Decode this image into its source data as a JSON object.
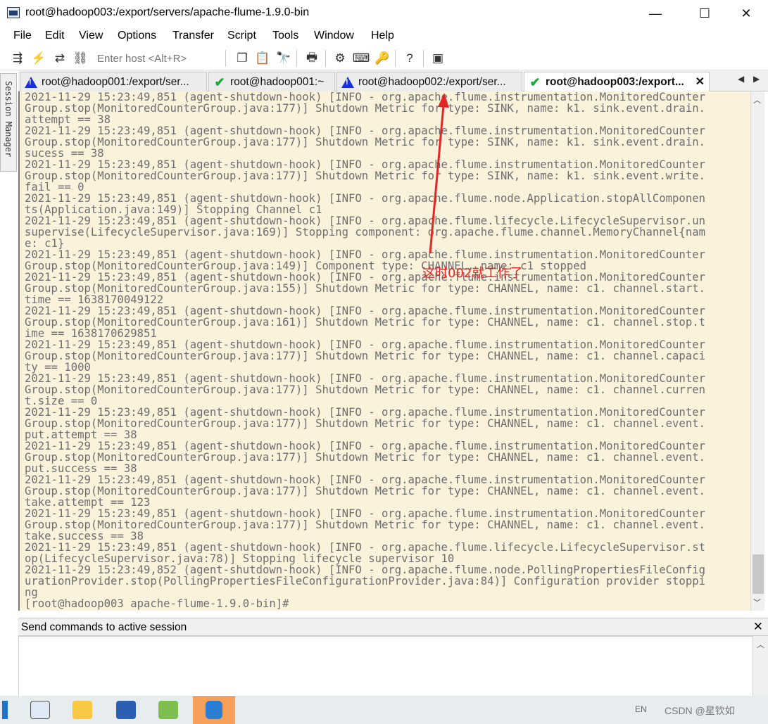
{
  "window": {
    "title": "root@hadoop003:/export/servers/apache-flume-1.9.0-bin",
    "minimize": "—",
    "maximize": "☐",
    "close": "✕"
  },
  "menu": [
    "File",
    "Edit",
    "View",
    "Options",
    "Transfer",
    "Script",
    "Tools",
    "Window",
    "Help"
  ],
  "toolbar": {
    "host_placeholder": "Enter host <Alt+R>",
    "icons": [
      "connect-icon",
      "quick-connect-icon",
      "reconnect-icon",
      "disconnect-icon",
      "copy-icon",
      "paste-icon",
      "find-icon",
      "print-icon",
      "settings-icon",
      "keymap-icon",
      "key-icon",
      "help-icon",
      "sftp-icon"
    ]
  },
  "session_manager": {
    "label": "Session Manager"
  },
  "tabs": [
    {
      "label": "root@hadoop001:/export/ser...",
      "status": "warning",
      "active": false
    },
    {
      "label": "root@hadoop001:~",
      "status": "ok",
      "active": false
    },
    {
      "label": "root@hadoop002:/export/ser...",
      "status": "warning",
      "active": false
    },
    {
      "label": "root@hadoop003:/export...",
      "status": "ok",
      "active": true
    }
  ],
  "terminal": {
    "lines": [
      "2021-11-29 15:23:49,851 (agent-shutdown-hook) [INFO - org.apache.flume.instrumentation.MonitoredCounter",
      "Group.stop(MonitoredCounterGroup.java:177)] Shutdown Metric for type: SINK, name: k1. sink.event.drain.",
      "attempt == 38",
      "2021-11-29 15:23:49,851 (agent-shutdown-hook) [INFO - org.apache.flume.instrumentation.MonitoredCounter",
      "Group.stop(MonitoredCounterGroup.java:177)] Shutdown Metric for type: SINK, name: k1. sink.event.drain.",
      "sucess == 38",
      "2021-11-29 15:23:49,851 (agent-shutdown-hook) [INFO - org.apache.flume.instrumentation.MonitoredCounter",
      "Group.stop(MonitoredCounterGroup.java:177)] Shutdown Metric for type: SINK, name: k1. sink.event.write.",
      "fail == 0",
      "2021-11-29 15:23:49,851 (agent-shutdown-hook) [INFO - org.apache.flume.node.Application.stopAllComponen",
      "ts(Application.java:149)] Stopping Channel c1",
      "2021-11-29 15:23:49,851 (agent-shutdown-hook) [INFO - org.apache.flume.lifecycle.LifecycleSupervisor.un",
      "supervise(LifecycleSupervisor.java:169)] Stopping component: org.apache.flume.channel.MemoryChannel{nam",
      "e: c1}",
      "2021-11-29 15:23:49,851 (agent-shutdown-hook) [INFO - org.apache.flume.instrumentation.MonitoredCounter",
      "Group.stop(MonitoredCounterGroup.java:149)] Component type: CHANNEL, name: c1 stopped",
      "2021-11-29 15:23:49,851 (agent-shutdown-hook) [INFO - org.apache.flume.instrumentation.MonitoredCounter",
      "Group.stop(MonitoredCounterGroup.java:155)] Shutdown Metric for type: CHANNEL, name: c1. channel.start.",
      "time == 1638170049122",
      "2021-11-29 15:23:49,851 (agent-shutdown-hook) [INFO - org.apache.flume.instrumentation.MonitoredCounter",
      "Group.stop(MonitoredCounterGroup.java:161)] Shutdown Metric for type: CHANNEL, name: c1. channel.stop.t",
      "ime == 1638170629851",
      "2021-11-29 15:23:49,851 (agent-shutdown-hook) [INFO - org.apache.flume.instrumentation.MonitoredCounter",
      "Group.stop(MonitoredCounterGroup.java:177)] Shutdown Metric for type: CHANNEL, name: c1. channel.capaci",
      "ty == 1000",
      "2021-11-29 15:23:49,851 (agent-shutdown-hook) [INFO - org.apache.flume.instrumentation.MonitoredCounter",
      "Group.stop(MonitoredCounterGroup.java:177)] Shutdown Metric for type: CHANNEL, name: c1. channel.curren",
      "t.size == 0",
      "2021-11-29 15:23:49,851 (agent-shutdown-hook) [INFO - org.apache.flume.instrumentation.MonitoredCounter",
      "Group.stop(MonitoredCounterGroup.java:177)] Shutdown Metric for type: CHANNEL, name: c1. channel.event.",
      "put.attempt == 38",
      "2021-11-29 15:23:49,851 (agent-shutdown-hook) [INFO - org.apache.flume.instrumentation.MonitoredCounter",
      "Group.stop(MonitoredCounterGroup.java:177)] Shutdown Metric for type: CHANNEL, name: c1. channel.event.",
      "put.success == 38",
      "2021-11-29 15:23:49,851 (agent-shutdown-hook) [INFO - org.apache.flume.instrumentation.MonitoredCounter",
      "Group.stop(MonitoredCounterGroup.java:177)] Shutdown Metric for type: CHANNEL, name: c1. channel.event.",
      "take.attempt == 123",
      "2021-11-29 15:23:49,851 (agent-shutdown-hook) [INFO - org.apache.flume.instrumentation.MonitoredCounter",
      "Group.stop(MonitoredCounterGroup.java:177)] Shutdown Metric for type: CHANNEL, name: c1. channel.event.",
      "take.success == 38",
      "2021-11-29 15:23:49,851 (agent-shutdown-hook) [INFO - org.apache.flume.lifecycle.LifecycleSupervisor.st",
      "op(LifecycleSupervisor.java:78)] Stopping lifecycle supervisor 10",
      "2021-11-29 15:23:49,852 (agent-shutdown-hook) [INFO - org.apache.flume.node.PollingPropertiesFileConfig",
      "urationProvider.stop(PollingPropertiesFileConfigurationProvider.java:84)] Configuration provider stoppi",
      "ng",
      "[root@hadoop003 apache-flume-1.9.0-bin]#"
    ],
    "bg_color": "#fbf2dc",
    "text_color": "#6e6e6e"
  },
  "annotation": {
    "text": "这时002就工作了",
    "color": "#e52525"
  },
  "command_window": {
    "title": "Send commands to active session",
    "close": "✕"
  },
  "taskbar": {
    "apps": [
      "start-icon",
      "securecrt-icon",
      "file-explorer-icon",
      "word-icon",
      "notepad-icon",
      "phone-link-icon"
    ],
    "lang": "EN",
    "watermark": "CSDN @星钦如"
  }
}
